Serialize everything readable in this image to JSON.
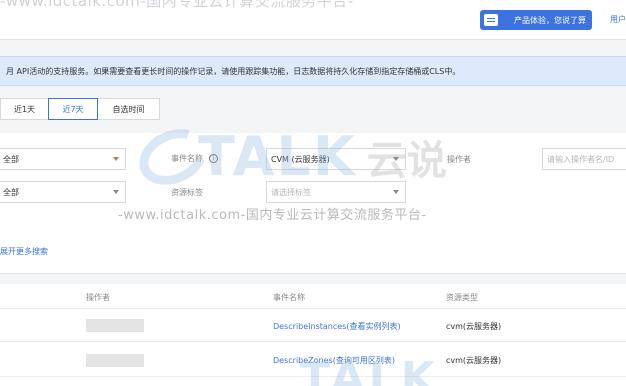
{
  "watermark": {
    "top_text": "-www.idctalk.com-国内专业云计算交流服务平台-",
    "brand": "TALK",
    "brand_cn": "云说",
    "url_text": "-www.idctalk.com-国内专业云计算交流服务平台-",
    "bottom_brand": "TALK"
  },
  "header": {
    "feedback_label": "产品体验，您说了算",
    "user_link": "用户"
  },
  "notice": {
    "text": "月 API活动的支持服务。如果需要查看更长时间的操作记录，请使用跟踪集功能，日志数据将持久化存储到指定存储桶或CLS中。"
  },
  "time_tabs": [
    {
      "label": "近1天"
    },
    {
      "label": "近7天",
      "active": true
    },
    {
      "label": "自选时间"
    }
  ],
  "filters": {
    "row1_select": "全部",
    "event_name_label": "事件名称",
    "event_name_value": "CVM (云服务器)",
    "operator_label": "操作者",
    "operator_placeholder": "请输入操作者名/ID",
    "row2_select": "全部",
    "resource_tag_label": "资源标签",
    "resource_tag_placeholder": "请选择标签",
    "more_search": "展开更多搜索"
  },
  "table": {
    "columns": [
      "操作者",
      "事件名称",
      "资源类型"
    ],
    "rows": [
      {
        "operator": "",
        "event": "DescribeInstances(查看实例列表)",
        "resource": "cvm(云服务器)"
      },
      {
        "operator": "",
        "event": "DescribeZones(查询可用区列表)",
        "resource": "cvm(云服务器)"
      }
    ]
  },
  "colors": {
    "accent": "#3d73e0",
    "notice_bg": "#dceafc"
  }
}
